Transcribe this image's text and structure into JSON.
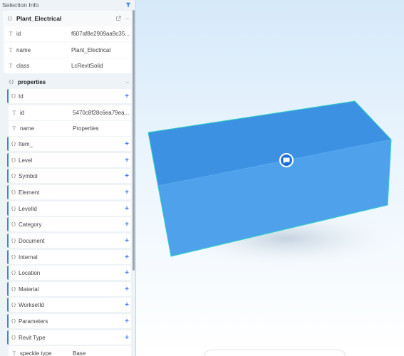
{
  "sidebar": {
    "title": "Selection Info",
    "object": {
      "name": "Plant_Electrical",
      "fields": [
        {
          "key": "id",
          "value": "f607af8e2909aa9c35..."
        },
        {
          "key": "name",
          "value": "Plant_Electrical"
        },
        {
          "key": "class",
          "value": "LcRevitSolid"
        }
      ]
    },
    "properties": {
      "name": "properties",
      "id_group": "Id",
      "fields": [
        {
          "key": "id",
          "value": "5470c8f28c6ea79ea..."
        },
        {
          "key": "name",
          "value": "Properties"
        }
      ],
      "groups": [
        "Item_",
        "Level",
        "Symbol",
        "Element",
        "LevelId",
        "Category",
        "Document",
        "Internal",
        "Location",
        "Material",
        "WorksetId",
        "Parameters",
        "Revit Type"
      ],
      "speckle": {
        "key": "speckle type",
        "value": "Base"
      }
    }
  },
  "icons": {
    "object": "braces-icon",
    "field": "text-type-icon",
    "expand": "plus-icon",
    "collapse": "minus-icon",
    "open": "external-link-icon",
    "filter": "filter-icon",
    "comment": "comment-icon"
  },
  "colors": {
    "accent": "#3b82f6",
    "box_top": "#3d91e2",
    "box_front": "#4ea1ea",
    "box_edge": "#2fd3c0"
  }
}
